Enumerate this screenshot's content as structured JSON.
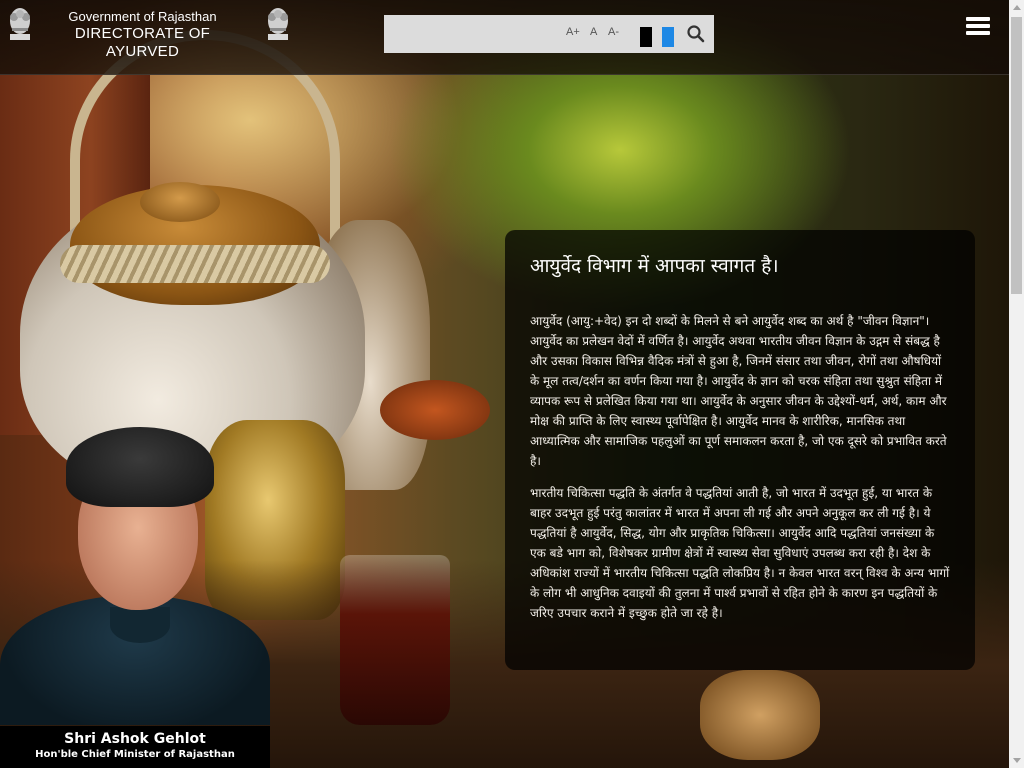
{
  "header": {
    "org_line1": "Government of Rajasthan",
    "org_line2": "DIRECTORATE OF AYURVED",
    "left_emblem_icon": "state-emblem-icon",
    "right_emblem_icon": "state-emblem-icon"
  },
  "toolbar": {
    "search_placeholder": "",
    "font_increase_label": "A+",
    "font_normal_label": "A",
    "font_decrease_label": "A-",
    "contrast_dark_color": "#000000",
    "contrast_blue_color": "#1e88e5",
    "search_icon": "search-icon",
    "menu_icon": "hamburger-menu-icon"
  },
  "welcome": {
    "title": "आयुर्वेद विभाग में आपका स्वागत है।",
    "paragraph1": "आयुर्वेद (आयु:+वेद) इन दो शब्दों के मिलने से बने आयुर्वेद शब्द का अर्थ है \"जीवन विज्ञान\"। आयुर्वेद का प्रलेखन वेदों में वर्णित है। आयुर्वेद अथवा भारतीय जीवन विज्ञान के उद्गम से संबद्ध है और उसका विकास विभिन्न वैदिक मंत्रों से हुआ है, जिनमें संसार तथा जीवन, रोगों तथा औषधियों के मूल तत्व/दर्शन का वर्णन किया गया है। आयुर्वेद के ज्ञान को चरक संहिता तथा सुश्रुत संहिता में व्यापक रूप से प्रलेखित किया गया था। आयुर्वेद के अनुसार जीवन के उद्देश्यों-धर्म, अर्थ, काम और मोक्ष की प्राप्ति के लिए स्वास्थ्य पूर्वापेक्षित है। आयुर्वेद मानव के शारीरिक, मानसिक तथा आध्यात्मिक और सामाजिक पहलुओं का पूर्ण समाकलन करता है, जो एक दूसरे को प्रभावित करते है।",
    "paragraph2": "भारतीय चिकित्सा पद्धति के अंतर्गत वे पद्धतियां आती है, जो भारत में उदभूत हुई, या भारत के बाहर उदभूत हुई परंतु कालांतर में भारत में अपना ली गई और अपने अनुकूल कर ली गई है। ये पद्धतियां है आयुर्वेद, सिद्ध, योग और प्राकृतिक चिकित्सा। आयुर्वेद आदि पद्धतियां जनसंख्या के एक बडे भाग को, विशेषकर ग्रामीण क्षेत्रों में स्वास्थ्य सेवा सुविधाएं उपलब्ध करा रही है। देश के अधिकांश राज्यों में भारतीय चिकित्सा पद्धति लोकप्रिय है। न केवल भारत वरन् विश्व के अन्य भागों के लोग भी आधुनिक दवाइयों की तुलना में पार्श्व प्रभावों से रहित होने के कारण इन पद्धतियों के जरिए उपचार कराने में इच्छुक होते जा रहे है।"
  },
  "cm": {
    "name": "Shri Ashok Gehlot",
    "designation": "Hon'ble Chief Minister of Rajasthan"
  }
}
